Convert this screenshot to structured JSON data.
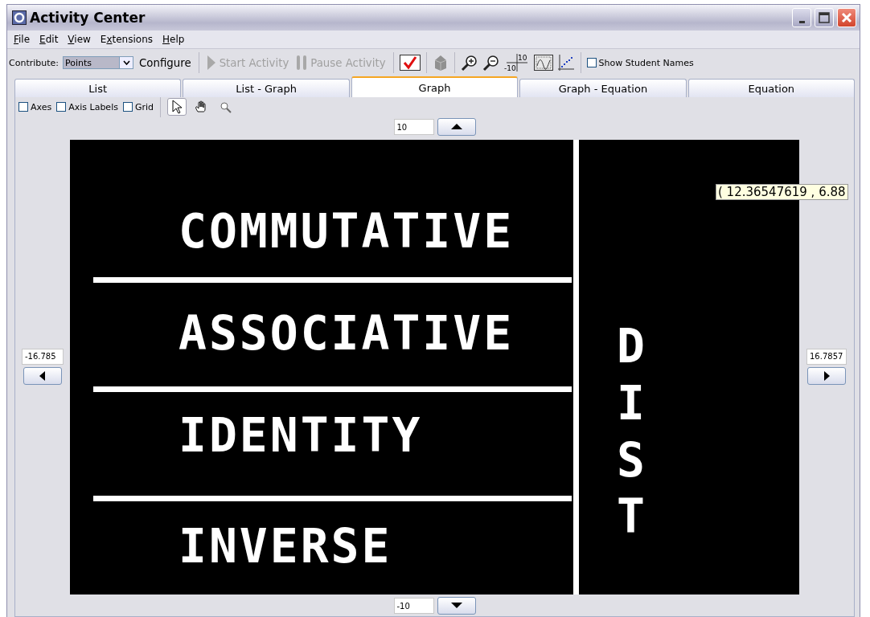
{
  "window": {
    "title": "Activity Center"
  },
  "menu": [
    {
      "label": "File"
    },
    {
      "label": "Edit"
    },
    {
      "label": "View"
    },
    {
      "label": "Extensions"
    },
    {
      "label": "Help"
    }
  ],
  "toolbar": {
    "contribute_label": "Contribute:",
    "contribute_value": "Points",
    "configure": "Configure",
    "start": {
      "label": "Start Activity",
      "disabled": true
    },
    "pause": {
      "label": "Pause Activity",
      "disabled": true
    },
    "window_icon_labels": [
      "10",
      "-10"
    ],
    "show_names": {
      "label": "Show Student Names",
      "checked": false
    }
  },
  "tabs": [
    {
      "label": "List",
      "selected": false
    },
    {
      "label": "List - Graph",
      "selected": false
    },
    {
      "label": "Graph",
      "selected": true
    },
    {
      "label": "Graph - Equation",
      "selected": false
    },
    {
      "label": "Equation",
      "selected": false
    }
  ],
  "options": [
    {
      "label": "Axes",
      "checked": false
    },
    {
      "label": "Axis Labels",
      "checked": false
    },
    {
      "label": "Grid",
      "checked": false
    }
  ],
  "tools": [
    {
      "kind": "pointer",
      "selected": true
    },
    {
      "kind": "hand",
      "selected": false
    },
    {
      "kind": "zoom",
      "selected": false
    }
  ],
  "range": {
    "ymax": "10",
    "ymin": "-10",
    "xmin": "-16.785",
    "xmax": "16.7857"
  },
  "graph": {
    "rows": [
      "COMMUTATIVE",
      "ASSOCIATIVE",
      "IDENTITY",
      "INVERSE"
    ],
    "side": "DIST",
    "tooltip": "( 12.36547619 , 6.88"
  }
}
